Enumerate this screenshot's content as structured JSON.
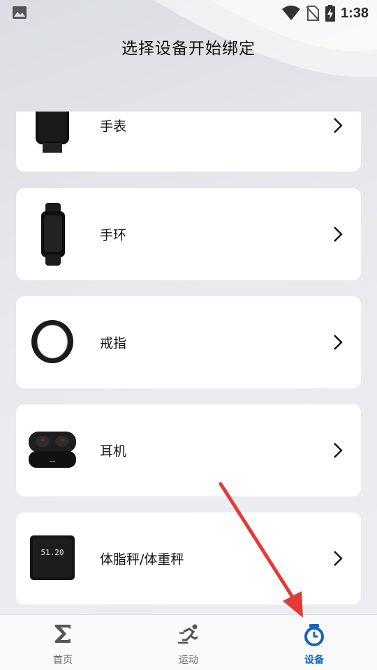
{
  "status_bar": {
    "time": "1:38",
    "icons": [
      "image-icon",
      "wifi-icon",
      "no-sim-icon",
      "battery-charging-icon"
    ]
  },
  "header": {
    "title": "选择设备开始绑定"
  },
  "devices": [
    {
      "label": "手表",
      "icon": "watch-image"
    },
    {
      "label": "手环",
      "icon": "band-image"
    },
    {
      "label": "戒指",
      "icon": "ring-image"
    },
    {
      "label": "耳机",
      "icon": "earbuds-image"
    },
    {
      "label": "体脂秤/体重秤",
      "icon": "scale-image",
      "scale_reading": "51.20"
    }
  ],
  "bottom_nav": {
    "items": [
      {
        "label": "首页",
        "icon": "sigma-icon",
        "active": false
      },
      {
        "label": "运动",
        "icon": "running-icon",
        "active": false
      },
      {
        "label": "设备",
        "icon": "watch-icon",
        "active": true
      }
    ]
  },
  "colors": {
    "accent": "#1565c0",
    "arrow": "#e53935"
  }
}
